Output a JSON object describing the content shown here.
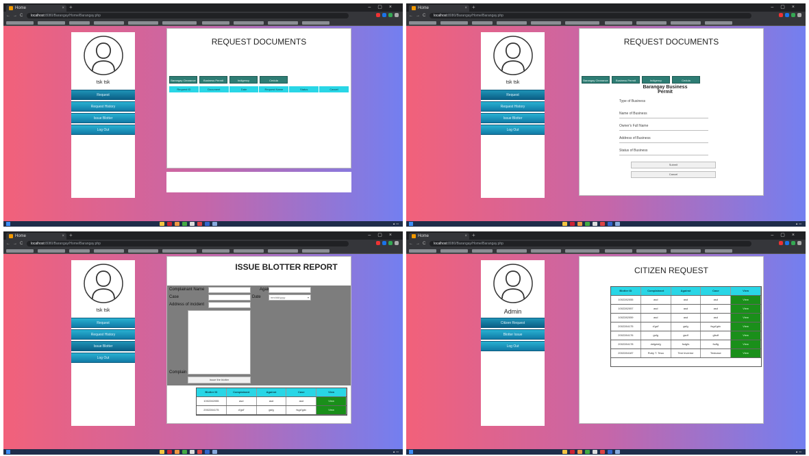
{
  "colors": {
    "accent": "#29d6e6",
    "button_teal": "#2e7d74",
    "view_green": "#1a8f1a",
    "sidebar_blue": "#117aa6"
  },
  "browser": {
    "tab_title": "Home",
    "url_host": "localhost",
    "url_path": "8080/Barangay/Home/Barangay.php"
  },
  "q1": {
    "username": "tsk tsk",
    "menu": [
      "Request",
      "Request History",
      "Issue Blotter",
      "Log Out"
    ],
    "title": "REQUEST DOCUMENTS",
    "doc_buttons": [
      "Barangay Clearance",
      "Business Permit",
      "Indigency",
      "Cedula"
    ],
    "columns": [
      "Request ID",
      "Document",
      "Date",
      "Request Name",
      "Status",
      "Cancel"
    ]
  },
  "q2": {
    "username": "tsk tsk",
    "menu": [
      "Request",
      "Request History",
      "Issue Blotter",
      "Log Out"
    ],
    "title": "REQUEST DOCUMENTS",
    "doc_buttons": [
      "Barangay Clearance",
      "Business Permit",
      "Indigency",
      "Cedula"
    ],
    "form_title": "Barangay Business Permit",
    "fields": [
      "Type of Business",
      "Name of Business",
      "Owner's Full Name",
      "Address of Business",
      "Status of Business"
    ],
    "submit": "Submit",
    "cancel": "Cancel"
  },
  "q3": {
    "username": "tsk tsk",
    "menu": [
      "Request",
      "Request History",
      "Issue Blotter",
      "Log Out"
    ],
    "title": "ISSUE BLOTTER REPORT",
    "labels": {
      "complainant": "Complainant Name",
      "against": "Against",
      "case": "Case",
      "date": "Date",
      "address": "Address of incident",
      "complain": "Complain"
    },
    "date_placeholder": "mm/dd/yyyy",
    "submit": "Issue the blotter",
    "columns": [
      "Blotter ID",
      "Complainant",
      "Against",
      "Case",
      "View"
    ],
    "rows": [
      [
        "1002282055",
        "asd",
        "asd",
        "asd",
        "View"
      ],
      [
        "2002284175",
        "d'gsf'",
        "gsfg",
        "fsgd'gdv",
        "View"
      ]
    ]
  },
  "q4": {
    "username": "Admin",
    "menu": [
      "Citizen Request",
      "Blotter Issue",
      "Log Out"
    ],
    "title": "CITIZEN REQUEST",
    "columns": [
      "Blotter ID",
      "Complainant",
      "Against",
      "Case",
      "View"
    ],
    "rows": [
      [
        "1002282055",
        "asd",
        "asd",
        "asd",
        "View"
      ],
      [
        "1002282057",
        "asd",
        "asd",
        "asd",
        "View"
      ],
      [
        "1002282059",
        "asd",
        "asd",
        "asd",
        "View"
      ],
      [
        "2002284175",
        "d'gsf'",
        "gsfg",
        "fsgd'gdv",
        "View"
      ],
      [
        "2002284176",
        "gsfg",
        "gsdf",
        "gfsdf",
        "View"
      ],
      [
        "2002284178",
        "dsfgdsfg",
        "fsdgfs",
        "fsdfg",
        "View"
      ],
      [
        "2002284187",
        "Ruby T. Tesa",
        "Test Inventor",
        "Testcase",
        "View"
      ]
    ]
  }
}
